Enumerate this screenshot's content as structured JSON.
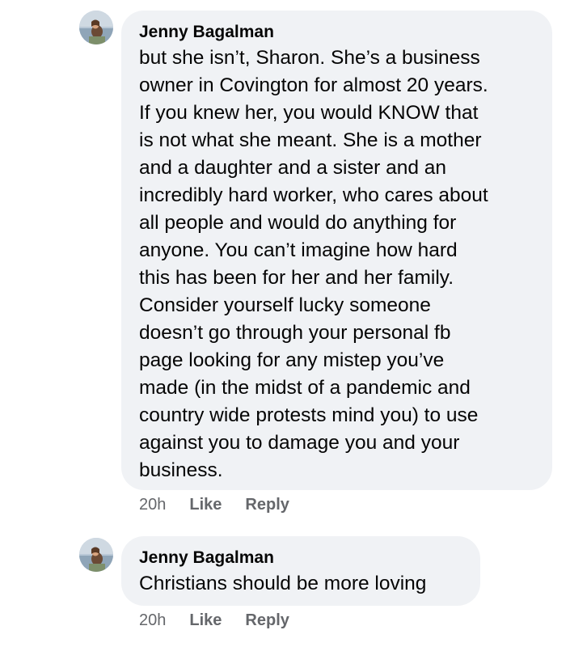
{
  "comments": [
    {
      "author": "Jenny Bagalman",
      "text": "but she isn’t, Sharon. She’s a business\nowner in Covington for almost 20 years.\nIf you knew her, you would KNOW that\nis not what she meant. She is a mother\nand a daughter and a sister and an\nincredibly hard worker, who cares about\nall people and would do anything for\nanyone. You can’t imagine how hard\nthis has been for her and her family.\nConsider yourself lucky someone\ndoesn’t go through your personal fb\npage looking for any mistep you’ve\nmade (in the midst of a pandemic and\ncountry wide protests mind you) to use\nagainst you to damage you and your\nbusiness.",
      "time": "20h",
      "like_label": "Like",
      "reply_label": "Reply"
    },
    {
      "author": "Jenny Bagalman",
      "text": "Christians should be more loving",
      "time": "20h",
      "like_label": "Like",
      "reply_label": "Reply"
    }
  ],
  "colors": {
    "bubble": "#f0f2f5",
    "meta_text": "#65676b",
    "body_text": "#050505"
  }
}
